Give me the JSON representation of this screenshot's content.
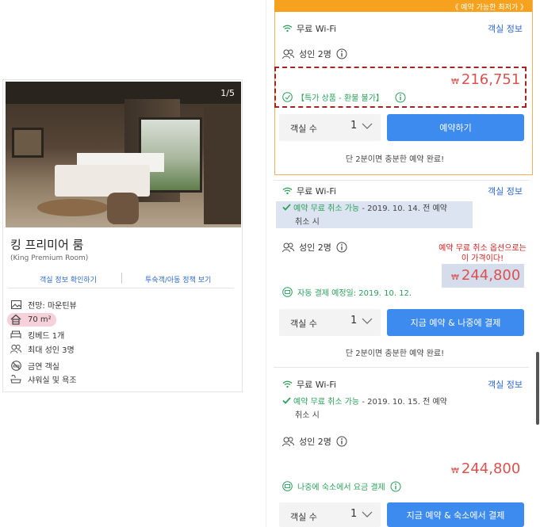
{
  "room": {
    "photo_counter": "1/5",
    "title": "킹 프리미어 룸",
    "subtitle": "(King Premium Room)",
    "link_room_info": "객실 정보 확인하기",
    "link_policy": "투숙객/아동 정책 보기",
    "amenities": [
      {
        "icon": "mountain-view-icon",
        "label": "전망: 마운틴뷰"
      },
      {
        "icon": "house-icon",
        "label": "70 m²"
      },
      {
        "icon": "bed-icon",
        "label": "킹베드 1개"
      },
      {
        "icon": "people-icon",
        "label": "최대 성인 3명"
      },
      {
        "icon": "no-smoking-icon",
        "label": "금연 객실"
      },
      {
        "icon": "shower-icon",
        "label": "샤워실 및 욕조"
      }
    ]
  },
  "offers": {
    "best_banner": "《 예약 가능한 최저가 》",
    "offer1": {
      "wifi": "무료 Wi-Fi",
      "room_info": "객실 정보",
      "adults": "성인 2명",
      "price_symbol": "₩",
      "price": "216,751",
      "deal": "【특가 상품 - 환불 불가】",
      "qty_label": "객실 수",
      "qty_value": "1",
      "button": "예약하기",
      "note": "단 2분이면 충분한 예약 완료!"
    },
    "offer2": {
      "wifi": "무료 Wi-Fi",
      "room_info": "객실 정보",
      "cancel_green": "예약 무료 취소 가능",
      "cancel_rest": " - 2019. 10. 14. 전 예약",
      "cancel_line2": "취소 시",
      "adults": "성인 2명",
      "annotation_line1": "예약 무료 취소 옵션으로는",
      "annotation_line2": "이 가격이다!",
      "price_symbol": "₩",
      "price": "244,800",
      "payment": "자동 결제 예정일: 2019. 10. 12.",
      "qty_label": "객실 수",
      "qty_value": "1",
      "button": "지금 예약 & 나중에 결제",
      "note": "단 2분이면 충분한 예약 완료!"
    },
    "offer3": {
      "wifi": "무료 Wi-Fi",
      "room_info": "객실 정보",
      "cancel_green": "예약 무료 취소 가능",
      "cancel_rest": " - 2019. 10. 15. 전 예약",
      "cancel_line2": "취소 시",
      "adults": "성인 2명",
      "price_symbol": "₩",
      "price": "244,800",
      "payment": "나중에 숙소에서 요금 결제",
      "qty_label": "객실 수",
      "qty_value": "1",
      "button": "지금 예약 & 숙소에서 결제"
    }
  },
  "colors": {
    "accent_blue": "#3d8bef",
    "price_red": "#d9534f",
    "green": "#2aa05a",
    "banner_orange": "#f6a21e"
  }
}
